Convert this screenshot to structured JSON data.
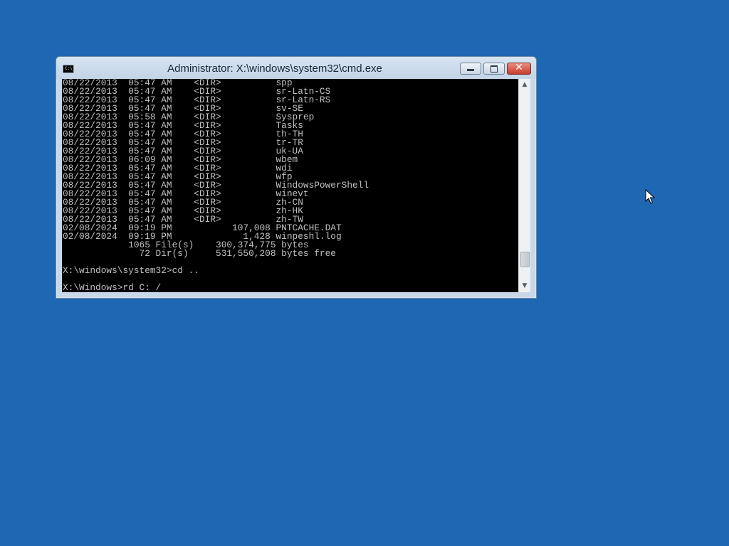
{
  "window": {
    "title": "Administrator: X:\\windows\\system32\\cmd.exe",
    "icon": "cmd-icon",
    "icon_text": "C:\\_",
    "buttons": {
      "minimize": "minimize-icon",
      "maximize": "maximize-icon",
      "close": "close-icon",
      "close_glyph": "✕"
    }
  },
  "console": {
    "lines": [
      "08/22/2013  05:47 AM    <DIR>          spp",
      "08/22/2013  05:47 AM    <DIR>          sr-Latn-CS",
      "08/22/2013  05:47 AM    <DIR>          sr-Latn-RS",
      "08/22/2013  05:47 AM    <DIR>          sv-SE",
      "08/22/2013  05:58 AM    <DIR>          Sysprep",
      "08/22/2013  05:47 AM    <DIR>          Tasks",
      "08/22/2013  05:47 AM    <DIR>          th-TH",
      "08/22/2013  05:47 AM    <DIR>          tr-TR",
      "08/22/2013  05:47 AM    <DIR>          uk-UA",
      "08/22/2013  06:09 AM    <DIR>          wbem",
      "08/22/2013  05:47 AM    <DIR>          wdi",
      "08/22/2013  05:47 AM    <DIR>          wfp",
      "08/22/2013  05:47 AM    <DIR>          WindowsPowerShell",
      "08/22/2013  05:47 AM    <DIR>          winevt",
      "08/22/2013  05:47 AM    <DIR>          zh-CN",
      "08/22/2013  05:47 AM    <DIR>          zh-HK",
      "08/22/2013  05:47 AM    <DIR>          zh-TW",
      "02/08/2024  09:19 PM           107,008 PNTCACHE.DAT",
      "02/08/2024  09:19 PM             1,428 winpeshl.log",
      "            1065 File(s)    300,374,775 bytes",
      "              72 Dir(s)     531,550,208 bytes free",
      "",
      "X:\\windows\\system32>cd ..",
      "",
      "X:\\Windows>rd C: /"
    ]
  },
  "scrollbar": {
    "up_arrow": "▲",
    "down_arrow": "▼",
    "position_fraction": 0.92
  },
  "colors": {
    "desktop_background": "#1e67b2",
    "console_background": "#000000",
    "console_text": "#c0c0c0",
    "close_button": "#c63b2b"
  },
  "cursor": "arrow-cursor-icon"
}
